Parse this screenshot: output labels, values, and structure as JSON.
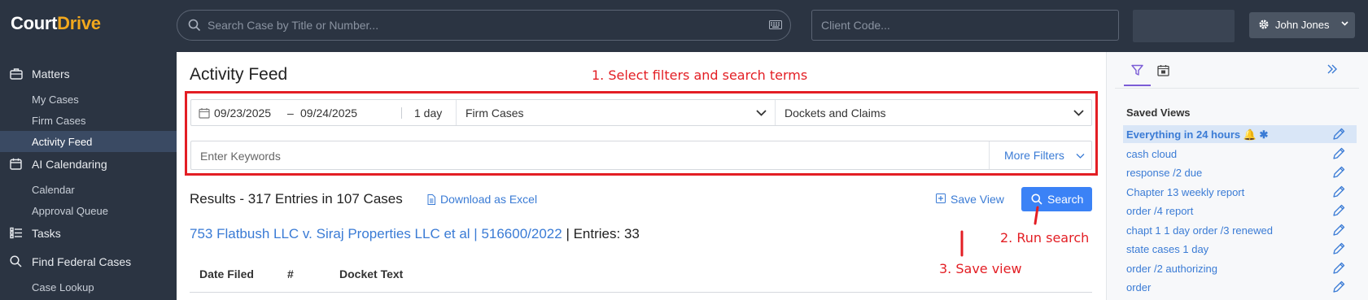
{
  "header": {
    "logo_part1": "Court",
    "logo_part2": "Drive",
    "search_placeholder": "Search Case by Title or Number...",
    "client_code_placeholder": "Client Code...",
    "user_name": "John Jones"
  },
  "sidebar": {
    "matters": "Matters",
    "my_cases": "My Cases",
    "firm_cases": "Firm Cases",
    "activity_feed": "Activity Feed",
    "ai_calendaring": "AI Calendaring",
    "calendar": "Calendar",
    "approval_queue": "Approval Queue",
    "tasks": "Tasks",
    "find_federal_cases": "Find Federal Cases",
    "case_lookup": "Case Lookup"
  },
  "main": {
    "title": "Activity Feed",
    "filters": {
      "date_from": "09/23/2025",
      "date_dash": "–",
      "date_to": "09/24/2025",
      "range": "1 day",
      "case_scope": "Firm Cases",
      "doc_type": "Dockets and Claims",
      "keywords_placeholder": "Enter Keywords",
      "more_filters": "More Filters"
    },
    "results_text": "Results - 317 Entries in 107 Cases",
    "download_label": "Download as Excel",
    "save_view_label": "Save View",
    "search_label": "Search",
    "case_title": "753 Flatbush LLC v. Siraj Properties LLC et al | 516600/2022",
    "case_sep": " | ",
    "case_entries": "Entries: 33",
    "table_headers": {
      "date_filed": "Date Filed",
      "num": "#",
      "docket_text": "Docket Text"
    }
  },
  "annotations": {
    "step1": "1. Select filters and search terms",
    "step2": "2. Run search",
    "step3": "3. Save view"
  },
  "saved_views": {
    "title": "Saved Views",
    "items": [
      "Everything in 24 hours 🔔 ✱",
      "cash cloud",
      "response /2 due",
      "Chapter 13 weekly report",
      "order /4 report",
      "chapt 1 1 day order /3 renewed",
      "state cases 1 day",
      "order /2 authorizing",
      "order"
    ]
  },
  "colors": {
    "sidebar_bg": "#2b3442",
    "accent_orange": "#f2a81d",
    "link_blue": "#3a7bd5",
    "button_blue": "#3b82f6",
    "annotation_red": "#e31e24",
    "tab_purple": "#7b5cd6"
  },
  "icons": [
    "search-icon",
    "keyboard-icon",
    "gear-icon",
    "chevron-down-icon",
    "briefcase-icon",
    "calendar-icon",
    "tasks-icon",
    "excel-icon",
    "save-view-icon",
    "filter-icon",
    "pencil-icon",
    "expand-panel-icon"
  ]
}
